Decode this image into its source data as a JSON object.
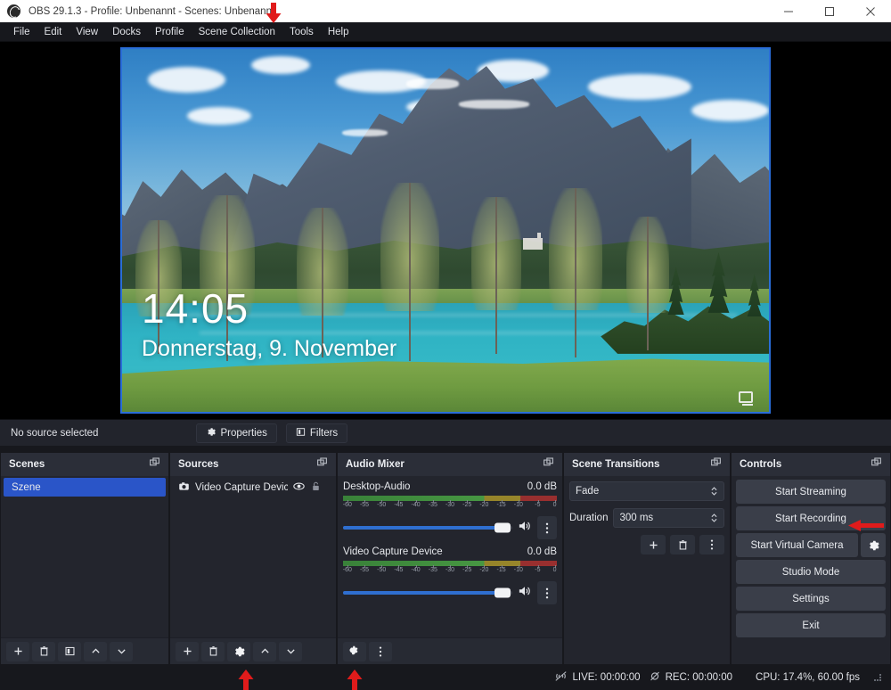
{
  "window": {
    "title": "OBS 29.1.3 - Profile: Unbenannt - Scenes: Unbenannt",
    "logo_icon": "obs-logo-icon",
    "minimize_icon": "minimize-icon",
    "maximize_icon": "maximize-icon",
    "close_icon": "close-icon"
  },
  "menubar": {
    "items": [
      {
        "label": "File"
      },
      {
        "label": "Edit"
      },
      {
        "label": "View"
      },
      {
        "label": "Docks"
      },
      {
        "label": "Profile"
      },
      {
        "label": "Scene Collection"
      },
      {
        "label": "Tools"
      },
      {
        "label": "Help"
      }
    ]
  },
  "preview": {
    "lock_screen": {
      "time": "14:05",
      "date": "Donnerstag, 9. November",
      "network_icon": "network-screen-icon"
    }
  },
  "source_toolbar": {
    "status": "No source selected",
    "properties_label": "Properties",
    "properties_icon": "gear-icon",
    "filters_label": "Filters",
    "filters_icon": "filters-icon"
  },
  "scenes": {
    "title": "Scenes",
    "popout_icon": "popout-icon",
    "items": [
      {
        "label": "Szene",
        "selected": true
      }
    ],
    "toolbar": [
      {
        "icon": "plus-icon",
        "name": "add-scene-button"
      },
      {
        "icon": "trash-icon",
        "name": "remove-scene-button"
      },
      {
        "icon": "scene-filters-icon",
        "name": "scene-filters-button"
      },
      {
        "icon": "chevron-up-icon",
        "name": "move-scene-up-button"
      },
      {
        "icon": "chevron-down-icon",
        "name": "move-scene-down-button"
      }
    ]
  },
  "sources": {
    "title": "Sources",
    "popout_icon": "popout-icon",
    "items": [
      {
        "label": "Video Capture Devic",
        "type_icon": "camera-icon",
        "visibility_icon": "eye-icon",
        "lock_icon": "unlocked-padlock-icon"
      }
    ],
    "toolbar": [
      {
        "icon": "plus-icon",
        "name": "add-source-button"
      },
      {
        "icon": "trash-icon",
        "name": "remove-source-button"
      },
      {
        "icon": "gear-icon",
        "name": "source-properties-button"
      },
      {
        "icon": "chevron-up-icon",
        "name": "move-source-up-button"
      },
      {
        "icon": "chevron-down-icon",
        "name": "move-source-down-button"
      }
    ]
  },
  "audio_mixer": {
    "title": "Audio Mixer",
    "popout_icon": "popout-icon",
    "tick_labels": [
      "-60",
      "-55",
      "-50",
      "-45",
      "-40",
      "-35",
      "-30",
      "-25",
      "-20",
      "-15",
      "-10",
      "-5",
      "0"
    ],
    "channels": [
      {
        "name": "Desktop-Audio",
        "db": "0.0 dB",
        "volume_percent": 94,
        "mute_icon": "speaker-icon",
        "menu_icon": "kebab-icon"
      },
      {
        "name": "Video Capture Device",
        "db": "0.0 dB",
        "volume_percent": 94,
        "mute_icon": "speaker-icon",
        "menu_icon": "kebab-icon"
      }
    ],
    "toolbar": [
      {
        "icon": "audio-settings-gear-icon",
        "name": "audio-advanced-properties-button"
      },
      {
        "icon": "kebab-icon",
        "name": "audio-mixer-menu-button"
      }
    ]
  },
  "scene_transitions": {
    "title": "Scene Transitions",
    "popout_icon": "popout-icon",
    "transition": "Fade",
    "duration_label": "Duration",
    "duration_value": "300 ms",
    "buttons": [
      {
        "icon": "plus-icon",
        "name": "add-transition-button"
      },
      {
        "icon": "trash-icon",
        "name": "remove-transition-button"
      },
      {
        "icon": "kebab-icon",
        "name": "transition-properties-button"
      }
    ]
  },
  "controls": {
    "title": "Controls",
    "popout_icon": "popout-icon",
    "start_streaming": "Start Streaming",
    "start_recording": "Start Recording",
    "start_virtual_camera": "Start Virtual Camera",
    "virtual_camera_gear_icon": "gear-icon",
    "studio_mode": "Studio Mode",
    "settings": "Settings",
    "exit": "Exit"
  },
  "statusbar": {
    "live_icon": "live-inactive-icon",
    "live": "LIVE: 00:00:00",
    "rec_icon": "rec-inactive-icon",
    "rec": "REC: 00:00:00",
    "cpu": "CPU: 17.4%, 60.00 fps",
    "grip_icon": "resize-grip-icon"
  },
  "annotations": {
    "arrow_color": "#e01b1b",
    "arrows": [
      {
        "name": "arrow-tools-menu",
        "direction": "down"
      },
      {
        "name": "arrow-start-recording",
        "direction": "left"
      },
      {
        "name": "arrow-source-properties",
        "direction": "up"
      },
      {
        "name": "arrow-audio-advanced",
        "direction": "up"
      }
    ]
  }
}
